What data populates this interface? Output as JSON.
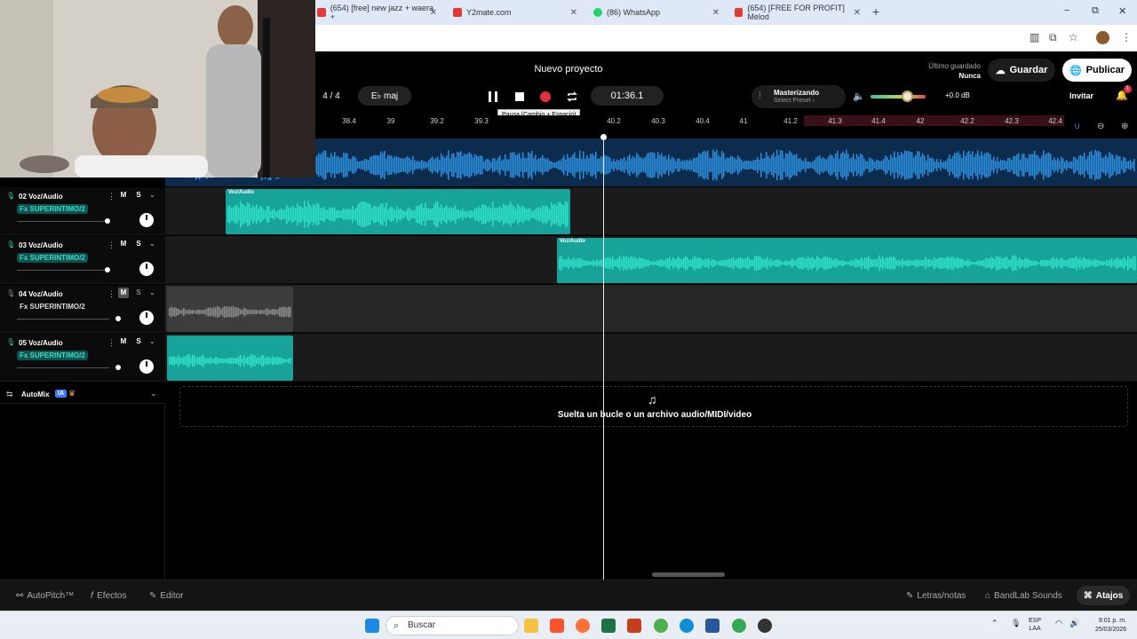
{
  "browser": {
    "tabs": [
      {
        "label": "(654) [free] new jazz + waera +",
        "favicon_color": "#e53935"
      },
      {
        "label": "Y2mate.com",
        "favicon_color": "#e53935"
      },
      {
        "label": "(86) WhatsApp",
        "favicon_color": "#25d366"
      },
      {
        "label": "(654) [FREE FOR PROFIT] Melod",
        "favicon_color": "#e53935"
      }
    ],
    "new_tab": "+",
    "window_controls": {
      "minimize": "−",
      "maximize": "⧉",
      "close": "✕"
    }
  },
  "header": {
    "project_title": "Nuevo proyecto",
    "last_saved_label": "Último guardado",
    "last_saved_value": "Nunca",
    "save_label": "Guardar",
    "publish_label": "Publicar",
    "time_signature": "4 / 4",
    "key": "E♭ maj",
    "time_display": "01:36.1",
    "tooltip": "Pausa (Cambio + Espacio)",
    "mastering_label": "Masterizando",
    "mastering_preset": "Select Preset ›",
    "volume_db": "+0.0 dB",
    "volume_level": 0.68,
    "invite_label": "Invitar",
    "notification_count": "1"
  },
  "ruler": {
    "ticks": [
      "38.4",
      "39",
      "39.2",
      "39.3",
      "40.2",
      "40.3",
      "40.4",
      "41",
      "41.2",
      "41.3",
      "41.4",
      "42",
      "42.2",
      "42.3",
      "42.4"
    ]
  },
  "tracks": [
    {
      "number": "02",
      "name": "Voz/Audio",
      "fx": "Fx SUPERINTIMO/2",
      "fx_active": true,
      "muted": false,
      "mute_label": "M",
      "solo_label": "S",
      "fader_level": 0.98,
      "clip_label": "Voz/Audio"
    },
    {
      "number": "03",
      "name": "Voz/Audio",
      "fx": "Fx SUPERINTIMO/2",
      "fx_active": true,
      "muted": false,
      "mute_label": "M",
      "solo_label": "S",
      "fader_level": 0.98,
      "clip_label": "Voz/Audio"
    },
    {
      "number": "04",
      "name": "Voz/Audio",
      "fx": "Fx SUPERINTIMO/2",
      "fx_active": false,
      "muted": true,
      "mute_label": "M",
      "solo_label": "S",
      "fader_level": 1.0,
      "clip_label": ""
    },
    {
      "number": "05",
      "name": "Voz/Audio",
      "fx": "Fx SUPERINTIMO/2",
      "fx_active": true,
      "muted": false,
      "mute_label": "M",
      "solo_label": "S",
      "fader_level": 1.0,
      "clip_label": ""
    }
  ],
  "track_labels": [
    "02 Voz/Audio",
    "03 Voz/Audio",
    "04 Voz/Audio",
    "05 Voz/Audio"
  ],
  "automix": {
    "label": "AutoMix",
    "badge": "IA"
  },
  "dropzone": {
    "text": "Suelta un bucle o un archivo audio/MIDI/video"
  },
  "bottombar": {
    "autopitch": "AutoPitch™",
    "effects": "Efectos",
    "editor": "Editor",
    "lyrics": "Letras/notas",
    "sounds": "BandLab Sounds",
    "shortcuts": "Atajos"
  },
  "taskbar": {
    "search_placeholder": "Buscar",
    "lang_line1": "ESP",
    "lang_line2": "LAA",
    "time": "9:01 p. m.",
    "date": "25/03/2026"
  },
  "colors": {
    "clip_teal": "#17a39a",
    "wave_teal": "#2fe0c8",
    "master_wave": "#2b8fe0",
    "record_red": "#e0303a"
  }
}
